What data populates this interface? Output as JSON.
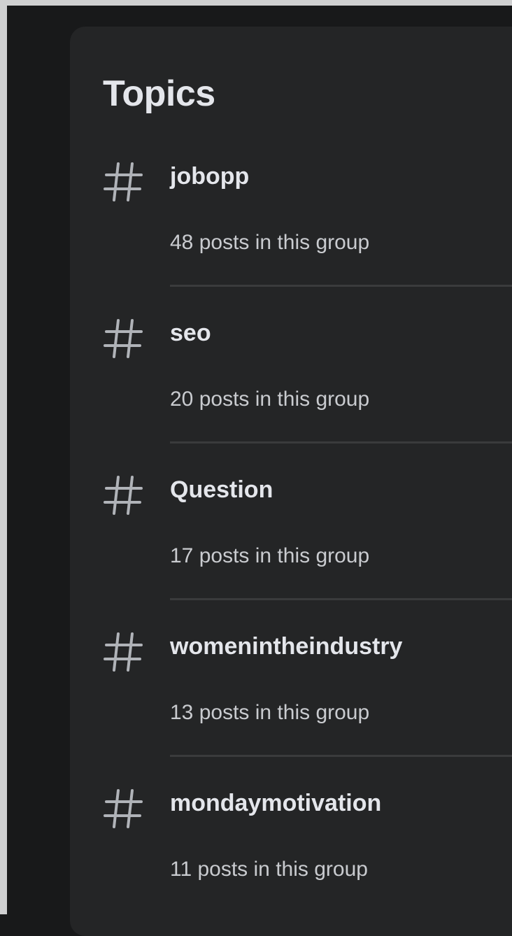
{
  "panel": {
    "title": "Topics"
  },
  "topics": [
    {
      "name": "jobopp",
      "count_text": "48 posts in this group",
      "icon": "hash-icon"
    },
    {
      "name": "seo",
      "count_text": "20 posts in this group",
      "icon": "hash-icon"
    },
    {
      "name": "Question",
      "count_text": "17 posts in this group",
      "icon": "hash-icon"
    },
    {
      "name": "womenintheindustry",
      "count_text": "13 posts in this group",
      "icon": "hash-icon"
    },
    {
      "name": "mondaymotivation",
      "count_text": "11 posts in this group",
      "icon": "hash-icon"
    }
  ],
  "colors": {
    "page_background": "#18191a",
    "card_background": "#242526",
    "primary_text": "#e4e6eb",
    "secondary_text": "#c9cbcf",
    "divider": "#3a3b3c"
  }
}
